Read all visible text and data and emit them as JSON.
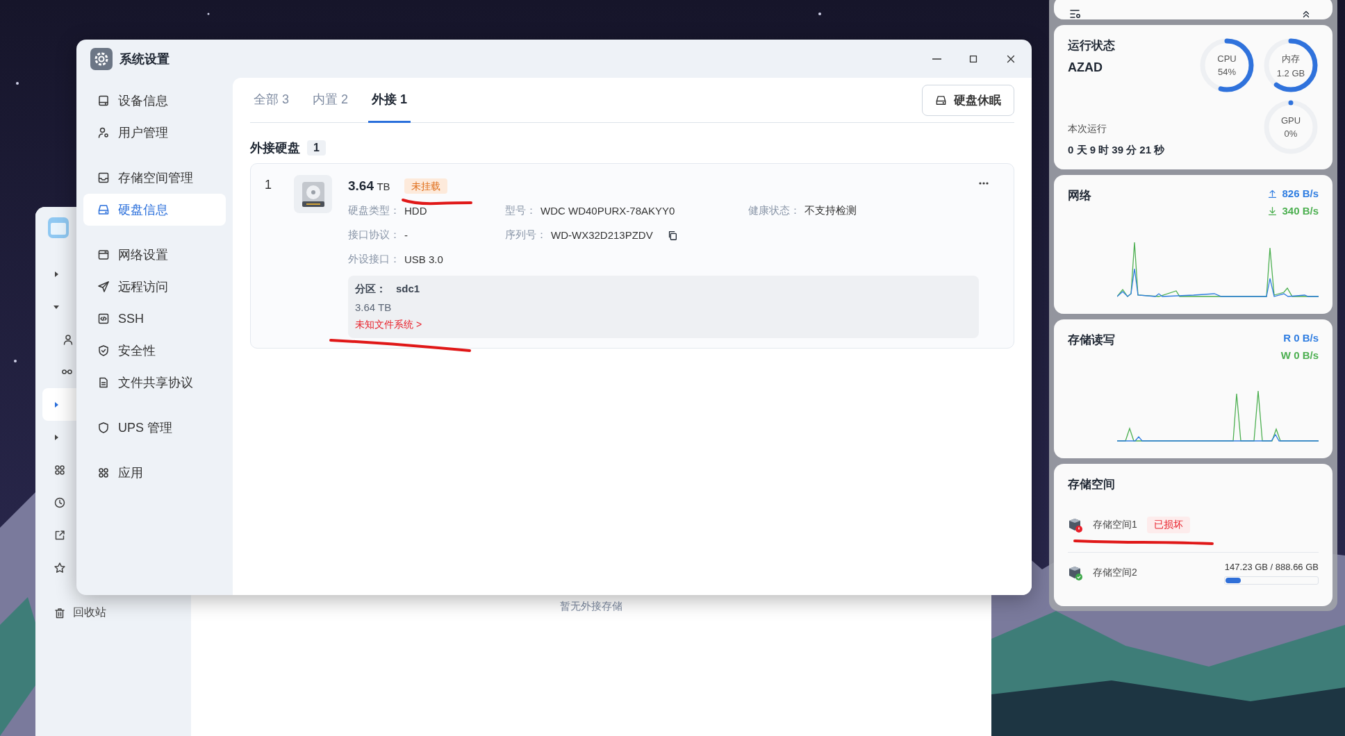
{
  "background_window": {
    "nav": [
      {
        "kind": "branch",
        "expanded": false,
        "selected": false
      },
      {
        "kind": "branch",
        "expanded": true,
        "selected": false
      },
      {
        "kind": "leaf",
        "selected": false
      },
      {
        "kind": "leaf",
        "selected": false
      },
      {
        "kind": "branch",
        "expanded": false,
        "selected": true
      },
      {
        "kind": "branch",
        "expanded": false,
        "selected": false
      },
      {
        "kind": "link",
        "selected": false
      },
      {
        "kind": "link",
        "selected": false
      },
      {
        "kind": "link",
        "selected": false
      },
      {
        "kind": "link",
        "selected": false
      },
      {
        "kind": "link",
        "selected": false,
        "label": "回收站"
      }
    ],
    "empty_text": "暂无外接存储"
  },
  "settings_window": {
    "title": "系统设置",
    "sidebar": [
      [
        {
          "label": "设备信息",
          "selected": false
        },
        {
          "label": "用户管理",
          "selected": false
        }
      ],
      [
        {
          "label": "存储空间管理",
          "selected": false
        },
        {
          "label": "硬盘信息",
          "selected": true
        }
      ],
      [
        {
          "label": "网络设置",
          "selected": false
        },
        {
          "label": "远程访问",
          "selected": false
        },
        {
          "label": "SSH",
          "selected": false
        },
        {
          "label": "安全性",
          "selected": false
        },
        {
          "label": "文件共享协议",
          "selected": false
        }
      ],
      [
        {
          "label": "UPS 管理",
          "selected": false
        }
      ],
      [
        {
          "label": "应用",
          "selected": false
        }
      ]
    ],
    "tabs": [
      {
        "label": "全部 3",
        "selected": false
      },
      {
        "label": "内置 2",
        "selected": false
      },
      {
        "label": "外接 1",
        "selected": true
      }
    ],
    "action_button": "硬盘休眠",
    "section": {
      "title": "外接硬盘",
      "count": "1"
    },
    "disks": [
      {
        "index": "1",
        "size": "3.64",
        "unit": "TB",
        "status": "未挂载",
        "field_rows": [
          [
            {
              "label": "硬盘类型：",
              "value": "HDD",
              "kind": "plain"
            },
            {
              "label": "型号：",
              "value": "WDC WD40PURX-78AKYY0",
              "kind": "plain"
            },
            {
              "label": "健康状态：",
              "value": "不支持检测",
              "kind": "plain"
            }
          ],
          [
            {
              "label": "接口协议：",
              "value": "-",
              "kind": "plain"
            },
            {
              "label": "序列号：",
              "value": "WD-WX32D213PZDV",
              "kind": "copyable"
            }
          ],
          [
            {
              "label": "外设接口：",
              "value": "USB 3.0",
              "kind": "plain"
            }
          ]
        ],
        "partition": {
          "label": "分区：",
          "name": "sdc1",
          "size": "3.64 TB",
          "link": "未知文件系统 >"
        }
      }
    ]
  },
  "widgets": {
    "status": {
      "title": "运行状态",
      "host": "AZAD",
      "uptime_label": "本次运行",
      "uptime": "0 天 9 时 39 分 21 秒",
      "gauges": [
        {
          "label": "CPU",
          "value": "54%",
          "level": 0.54
        },
        {
          "label": "内存",
          "value": "1.2 GB",
          "level": 0.6
        },
        {
          "label": "GPU",
          "value": "0%",
          "level": 0
        }
      ]
    },
    "network": {
      "title": "网络",
      "rates": [
        {
          "kind": "up",
          "value": "826 B/s",
          "color": "#2f7de1"
        },
        {
          "kind": "down",
          "value": "340 B/s",
          "color": "#4caf50"
        }
      ]
    },
    "storage_io": {
      "title": "存储读写",
      "rates": [
        {
          "value": "R  0 B/s",
          "color": "#2f7de1"
        },
        {
          "value": "W  0 B/s",
          "color": "#4caf50"
        }
      ]
    },
    "storage_spaces": {
      "title": "存储空间",
      "items": [
        {
          "name": "存储空间1",
          "kind": "error",
          "badge": "已损坏"
        },
        {
          "name": "存储空间2",
          "kind": "ok",
          "usage": "147.23 GB / 888.66 GB",
          "level": 0.17
        }
      ]
    }
  }
}
